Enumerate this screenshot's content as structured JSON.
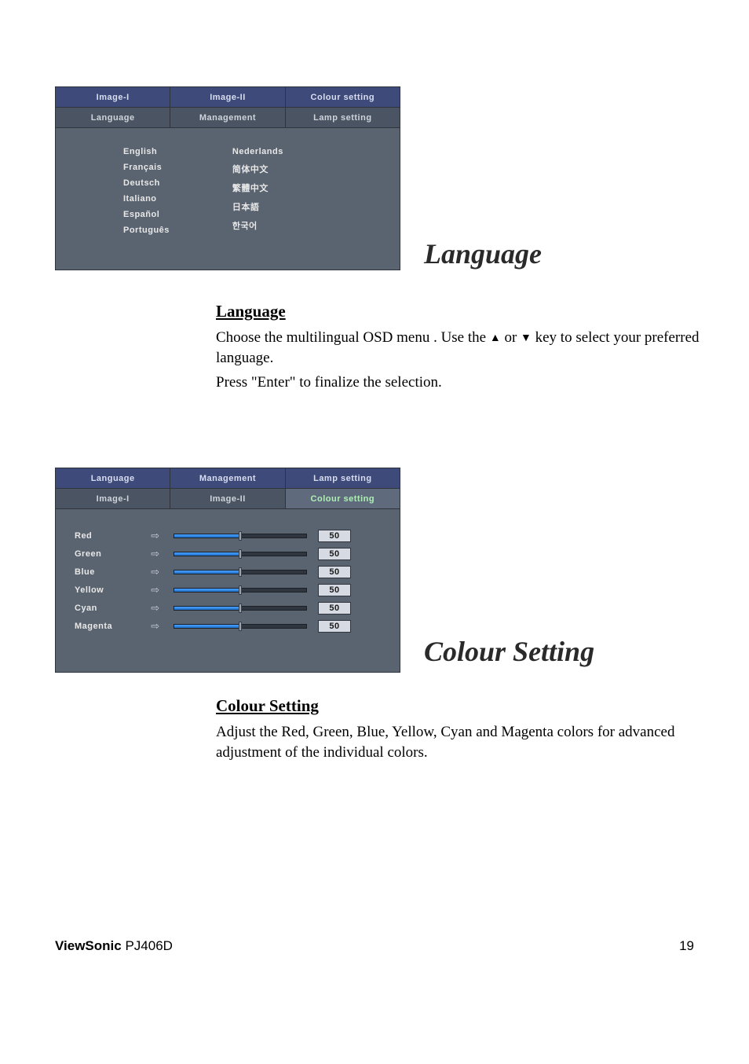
{
  "osd_language": {
    "tabs_row1": [
      "Image-I",
      "Image-II",
      "Colour setting"
    ],
    "tabs_row2": [
      "Language",
      "Management",
      "Lamp setting"
    ],
    "col1": [
      "English",
      "Français",
      "Deutsch",
      "Italiano",
      "Español",
      "Português"
    ],
    "col2": [
      "Nederlands",
      "简体中文",
      "繁體中文",
      "日本語",
      "한국어"
    ]
  },
  "side_title_1": "Language",
  "lang_section": {
    "heading": "Language",
    "p1a": "Choose the multilingual OSD menu . Use the ",
    "p1b": " or ",
    "p1c": " key to select your preferred language.",
    "p2": "Press \"Enter\" to finalize the selection."
  },
  "osd_colour": {
    "tabs_row1": [
      "Language",
      "Management",
      "Lamp setting"
    ],
    "tabs_row2": [
      "Image-I",
      "Image-II",
      "Colour setting"
    ],
    "rows": [
      {
        "label": "Red",
        "value": 50
      },
      {
        "label": "Green",
        "value": 50
      },
      {
        "label": "Blue",
        "value": 50
      },
      {
        "label": "Yellow",
        "value": 50
      },
      {
        "label": "Cyan",
        "value": 50
      },
      {
        "label": "Magenta",
        "value": 50
      }
    ]
  },
  "side_title_2": "Colour Setting",
  "colour_section": {
    "heading": "Colour Setting",
    "p1": "Adjust the Red, Green, Blue, Yellow, Cyan and Magenta colors for advanced adjustment of the individual colors."
  },
  "footer": {
    "brand_bold": "ViewSonic",
    "brand_model": " PJ406D",
    "page": "19"
  }
}
